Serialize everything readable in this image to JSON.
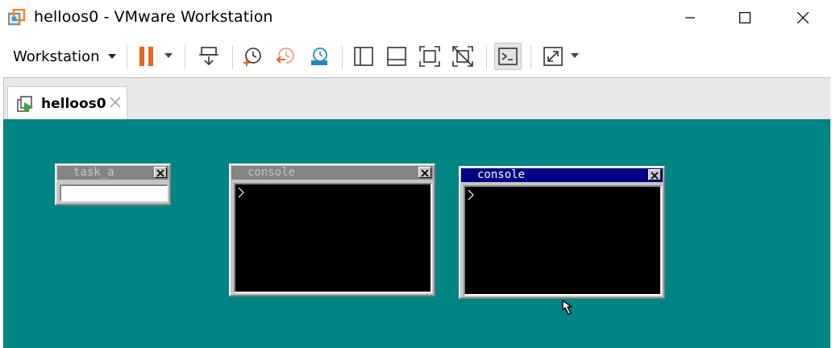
{
  "window": {
    "title": "helloos0 - VMware Workstation",
    "controls": [
      "minimize",
      "maximize",
      "close"
    ]
  },
  "toolbar": {
    "menu_label": "Workstation",
    "buttons": [
      {
        "icon": "pause-icon",
        "color": "#e8661f"
      },
      {
        "icon": "send-ctrl-alt-del-icon"
      },
      {
        "icon": "take-snapshot-icon"
      },
      {
        "icon": "revert-snapshot-icon"
      },
      {
        "icon": "snapshot-manager-icon"
      },
      {
        "icon": "show-library-icon"
      },
      {
        "icon": "show-thumbnail-bar-icon"
      },
      {
        "icon": "full-screen-icon"
      },
      {
        "icon": "unity-icon"
      },
      {
        "icon": "console-view-icon",
        "active": true
      },
      {
        "icon": "stretch-guest-icon"
      }
    ]
  },
  "tabs": [
    {
      "label": "helloos0",
      "active": true
    }
  ],
  "vm": {
    "background": "#008484",
    "windows": [
      {
        "title": "task_a",
        "type": "textbox",
        "active": false
      },
      {
        "title": "console",
        "type": "console",
        "active": false,
        "prompt": ">"
      },
      {
        "title": "console",
        "type": "console",
        "active": true,
        "prompt": ">"
      }
    ]
  },
  "colors": {
    "accent_orange": "#e8661f",
    "active_title": "#000084",
    "inactive_title": "#848484",
    "window_face": "#c6c6c6"
  }
}
